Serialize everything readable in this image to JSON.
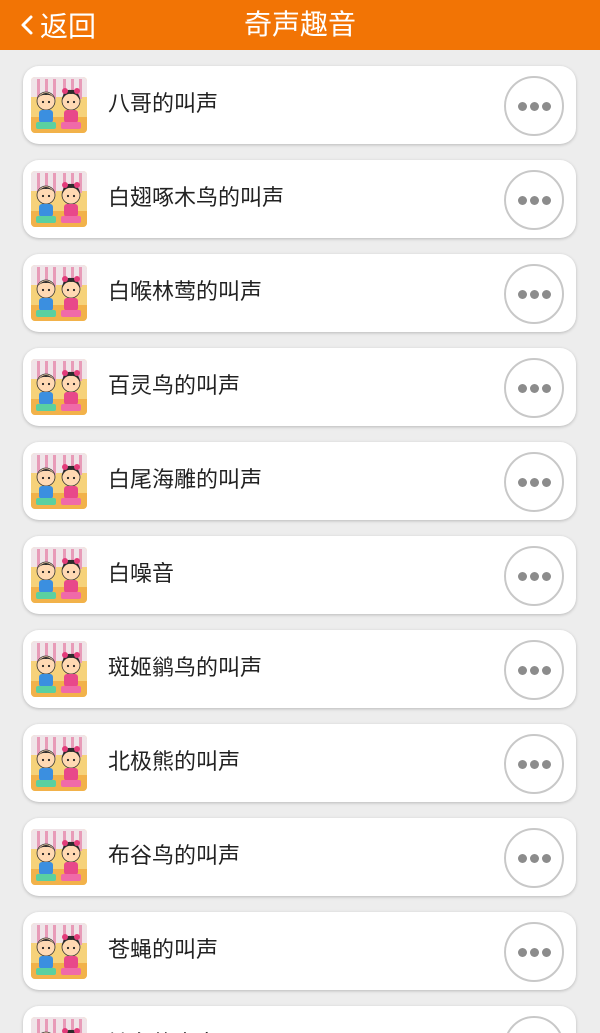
{
  "header": {
    "back_label": "返回",
    "title": "奇声趣音",
    "background": "#f27405"
  },
  "sounds": [
    {
      "name": "八哥的叫声"
    },
    {
      "name": "白翅啄木鸟的叫声"
    },
    {
      "name": "白喉林莺的叫声"
    },
    {
      "name": "百灵鸟的叫声"
    },
    {
      "name": "白尾海雕的叫声"
    },
    {
      "name": "白噪音"
    },
    {
      "name": "斑姬鹟鸟的叫声"
    },
    {
      "name": "北极熊的叫声"
    },
    {
      "name": "布谷鸟的叫声"
    },
    {
      "name": "苍蝇的叫声"
    },
    {
      "name": "铲车的声音"
    }
  ],
  "icons": {
    "thumbnail": "kids-cartoon-icon",
    "more": "more-dots-icon",
    "back": "chevron-left-icon"
  }
}
